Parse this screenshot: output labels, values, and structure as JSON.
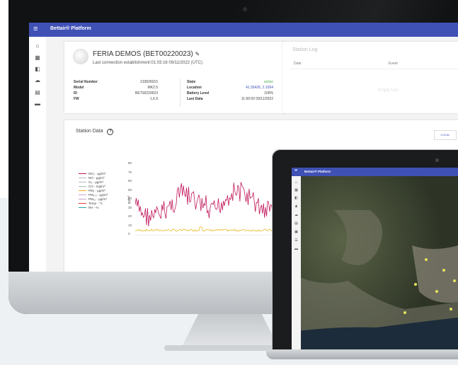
{
  "app": {
    "title": "Bettair® Platform"
  },
  "device": {
    "name": "FERIA DEMOS (BET00220023)",
    "connection": "Last connection establishment:01:03:16 09/11/2022 (UTC)",
    "left_fields": [
      {
        "label": "Serial Number",
        "value": "210826015"
      },
      {
        "label": "Model",
        "value": "MK2.5"
      },
      {
        "label": "ID",
        "value": "BET00220023"
      },
      {
        "label": "FW",
        "value": "1.6.9"
      }
    ],
    "right_fields": [
      {
        "label": "State",
        "value": "active",
        "color": "#4caf50"
      },
      {
        "label": "Location",
        "value": "41.35426, 2.1094",
        "color": "#3f51b5"
      },
      {
        "label": "Battery Level",
        "value": "100%",
        "color": "#444444"
      },
      {
        "label": "Last Data",
        "value": "11:50:00 09/11/2022",
        "color": "#444444"
      }
    ]
  },
  "station_log": {
    "title": "Station Log",
    "columns": [
      "Date",
      "Event"
    ],
    "empty_text": "Empty List"
  },
  "station_data": {
    "title": "Station Data",
    "range_button": "LOCAL",
    "y_axis_title": "µg/m³",
    "y_ticks": [
      "80",
      "70",
      "60",
      "50",
      "40",
      "30",
      "20",
      "10",
      "0"
    ],
    "legend": [
      {
        "label": "NO₂ - µg/m³",
        "color": "#c2185b"
      },
      {
        "label": "NO - µg/m³",
        "color": "#b0bec5"
      },
      {
        "label": "O₃ - µg/m³",
        "color": "#b0bec5"
      },
      {
        "label": "CO - mg/m³",
        "color": "#b0bec5"
      },
      {
        "label": "PM₁ - µg/m³",
        "color": "#f9a825"
      },
      {
        "label": "PM₂.₅ - µg/m³",
        "color": "#c5a3c9"
      },
      {
        "label": "PM₁₀ - µg/m³",
        "color": "#c5a3c9"
      },
      {
        "label": "Temp - °C",
        "color": "#e53935"
      },
      {
        "label": "RH - %",
        "color": "#26a69a"
      }
    ]
  },
  "colors": {
    "primary": "#3f51b5",
    "no2": "#c2185b",
    "pm1": "#e8b923"
  },
  "sidebar_icons": [
    "home-icon",
    "dashboard-icon",
    "devices-icon",
    "cloud-icon",
    "document-icon",
    "feedback-icon"
  ],
  "laptop": {
    "title": "Bettair® Platform",
    "sidebar_icons": [
      "home-icon",
      "dashboard-icon",
      "devices-icon",
      "bell-icon",
      "cloud-icon",
      "document-icon",
      "calendar-icon",
      "list-icon",
      "feedback-icon"
    ]
  }
}
